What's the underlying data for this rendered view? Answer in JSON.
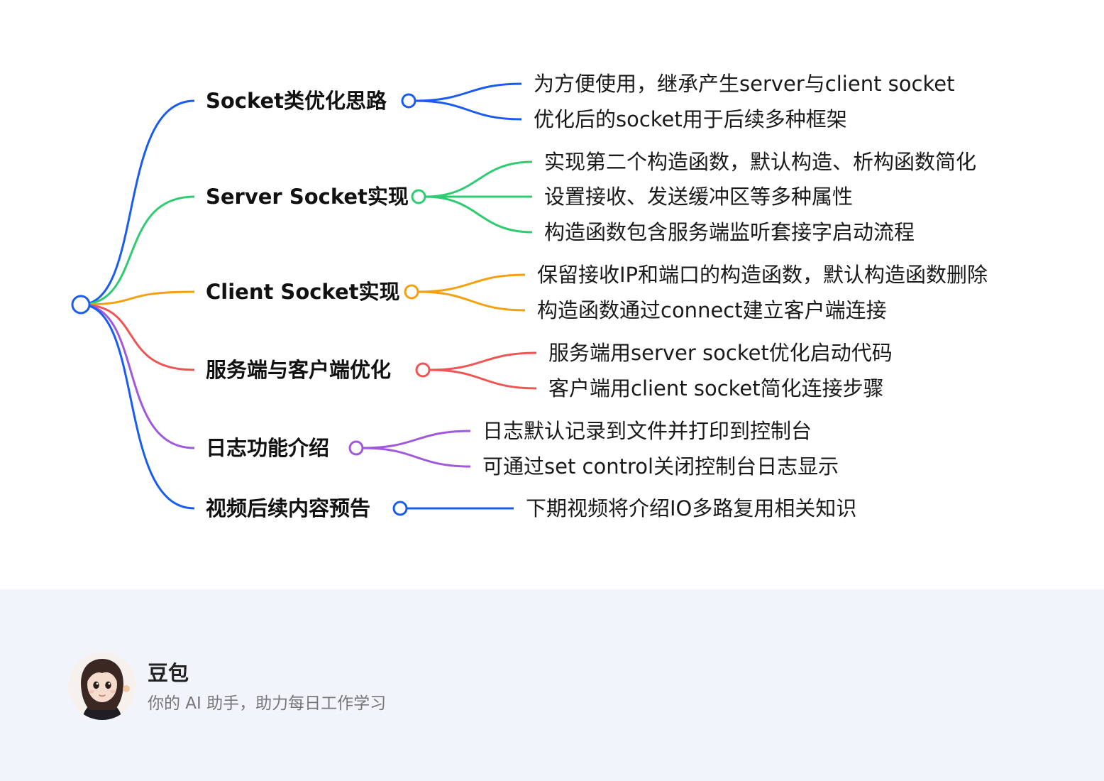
{
  "mindmap": {
    "root_color": "#1a5cf0",
    "branches": [
      {
        "label": "Socket类优化思路",
        "color": "#1a5cf0",
        "children": [
          "为方便使用，继承产生server与client socket",
          "优化后的socket用于后续多种框架"
        ]
      },
      {
        "label": "Server Socket实现",
        "color": "#2ecc71",
        "children": [
          "实现第二个构造函数，默认构造、析构函数简化",
          "设置接收、发送缓冲区等多种属性",
          "构造函数包含服务端监听套接字启动流程"
        ]
      },
      {
        "label": "Client Socket实现",
        "color": "#f5a00f",
        "children": [
          "保留接收IP和端口的构造函数，默认构造函数删除",
          "构造函数通过connect建立客户端连接"
        ]
      },
      {
        "label": "服务端与客户端优化",
        "color": "#f05555",
        "children": [
          "服务端用server socket优化启动代码",
          "客户端用client socket简化连接步骤"
        ]
      },
      {
        "label": "日志功能介绍",
        "color": "#a058dc",
        "children": [
          "日志默认记录到文件并打印到控制台",
          "可通过set control关闭控制台日志显示"
        ]
      },
      {
        "label": "视频后续内容预告",
        "color": "#1a5cf0",
        "children": [
          "下期视频将介绍IO多路复用相关知识"
        ]
      }
    ]
  },
  "footer": {
    "name": "豆包",
    "tagline": "你的 AI 助手，助力每日工作学习"
  }
}
